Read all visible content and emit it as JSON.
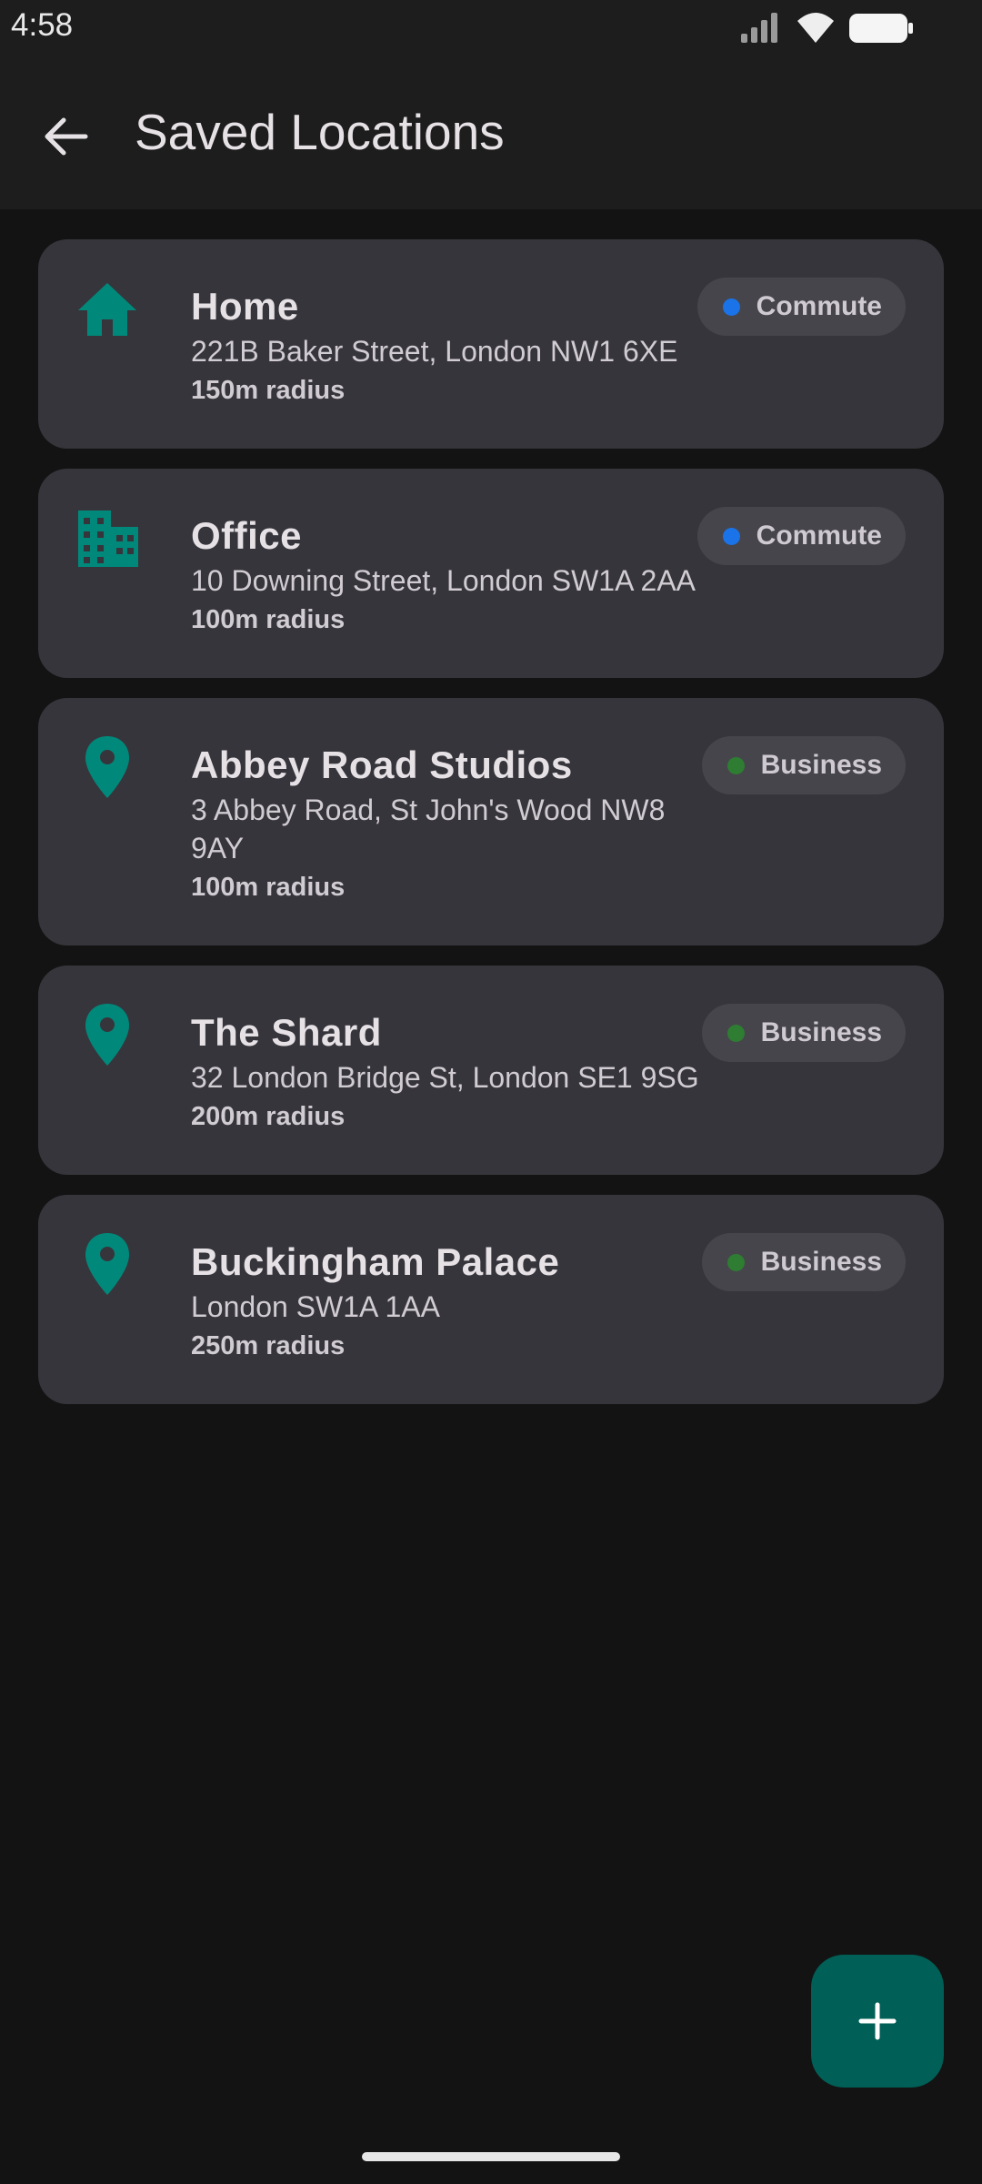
{
  "status_bar": {
    "time": "4:58"
  },
  "app_bar": {
    "title": "Saved Locations",
    "back_icon": "arrow-back-icon"
  },
  "colors": {
    "accent": "#00897b",
    "commute_dot": "#1a73e8",
    "business_dot": "#2e7d32",
    "fab_bg": "#005f56"
  },
  "locations": [
    {
      "name": "Home",
      "address": "221B Baker Street, London NW1 6XE",
      "radius": "150m radius",
      "tag": "Commute",
      "icon": "home-icon"
    },
    {
      "name": "Office",
      "address": "10 Downing Street, London SW1A 2AA",
      "radius": "100m radius",
      "tag": "Commute",
      "icon": "office-building-icon"
    },
    {
      "name": "Abbey Road Studios",
      "address": "3 Abbey Road, St John's Wood NW8 9AY",
      "radius": "100m radius",
      "tag": "Business",
      "icon": "map-pin-icon"
    },
    {
      "name": "The Shard",
      "address": "32 London Bridge St, London SE1 9SG",
      "radius": "200m radius",
      "tag": "Business",
      "icon": "map-pin-icon"
    },
    {
      "name": "Buckingham Palace",
      "address": "London SW1A 1AA",
      "radius": "250m radius",
      "tag": "Business",
      "icon": "map-pin-icon"
    }
  ],
  "fab": {
    "icon": "add-icon"
  }
}
